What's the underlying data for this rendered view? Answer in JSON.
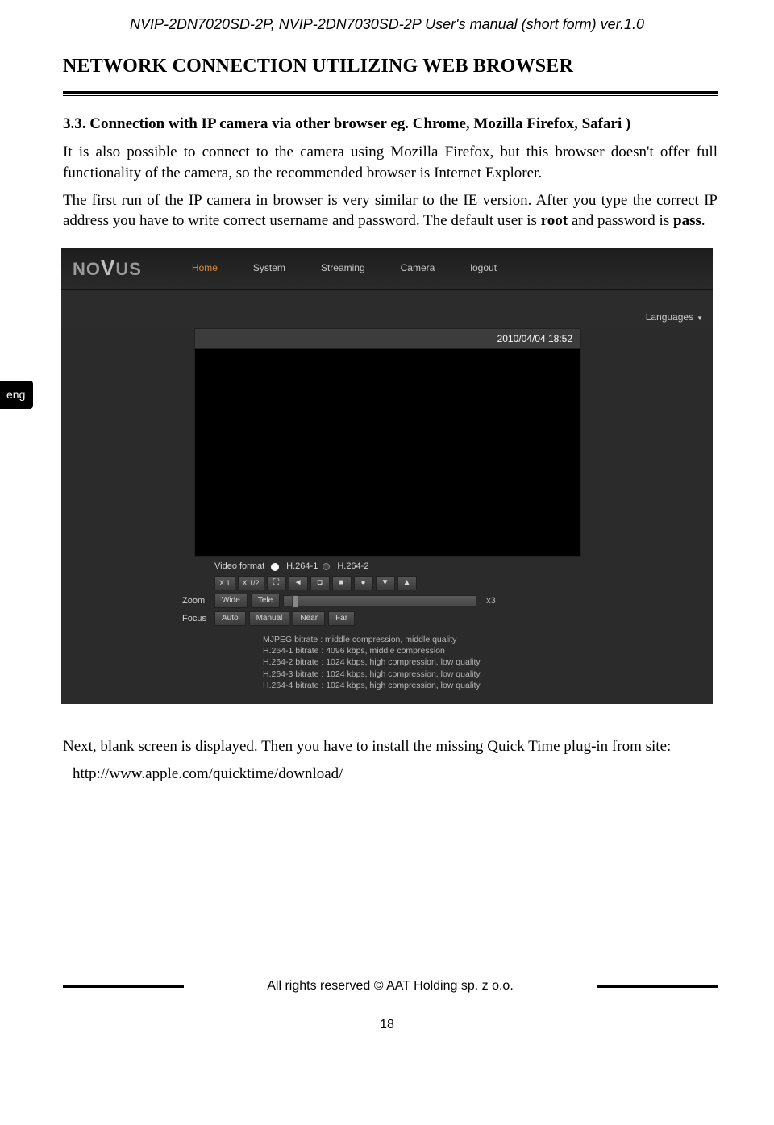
{
  "doc_header": "NVIP-2DN7020SD-2P, NVIP-2DN7030SD-2P User's manual (short form) ver.1.0",
  "section_title": "NETWORK CONNECTION UTILIZING WEB BROWSER",
  "sub_title": "3.3. Connection with IP camera via other browser eg. Chrome, Mozilla Firefox, Safari )",
  "para1": "It is also possible to connect to the camera using Mozilla Firefox, but this browser doesn't offer full functionality of the camera, so the recommended browser is Internet Explorer.",
  "para2_a": "The first run of the IP camera in browser is very similar to  the IE version. After you type the correct IP address you have to write correct username and password. The default user is ",
  "para2_b_root": "root",
  "para2_c": " and password is ",
  "para2_d_pass": "pass",
  "para2_e": ".",
  "side_tab": "eng",
  "shot": {
    "logo_a": "NO",
    "logo_v": "V",
    "logo_b": "US",
    "nav": {
      "home": "Home",
      "system": "System",
      "streaming": "Streaming",
      "camera": "Camera",
      "logout": "logout"
    },
    "languages": "Languages",
    "timestamp": "2010/04/04 18:52",
    "vf_label": "Video format",
    "vf_1": "H.264-1",
    "vf_2": "H.264-2",
    "btns": {
      "x1": "X 1",
      "x12": "X 1/2",
      "full": "⛶",
      "bwd": "◄",
      "snap": "◘",
      "stop": "■",
      "rec": "●",
      "down": "▼",
      "up": "▲"
    },
    "zoom_label": "Zoom",
    "zoom_wide": "Wide",
    "zoom_tele": "Tele",
    "zoom_val": "x3",
    "focus_label": "Focus",
    "focus_auto": "Auto",
    "focus_manual": "Manual",
    "focus_near": "Near",
    "focus_far": "Far",
    "bitlines": {
      "l1": "MJPEG bitrate : middle compression, middle quality",
      "l2": "H.264-1 bitrate : 4096 kbps, middle compression",
      "l3": "H.264-2 bitrate : 1024 kbps, high compression, low quality",
      "l4": "H.264-3 bitrate : 1024 kbps, high compression, low quality",
      "l5": "H.264-4 bitrate : 1024 kbps, high compression, low quality"
    }
  },
  "after1": "Next, blank screen is displayed. Then you have to install the missing Quick Time plug-in from site:",
  "after2": "http://www.apple.com/quicktime/download/",
  "footer": "All rights reserved ©  AAT Holding sp. z o.o.",
  "page_num": "18"
}
